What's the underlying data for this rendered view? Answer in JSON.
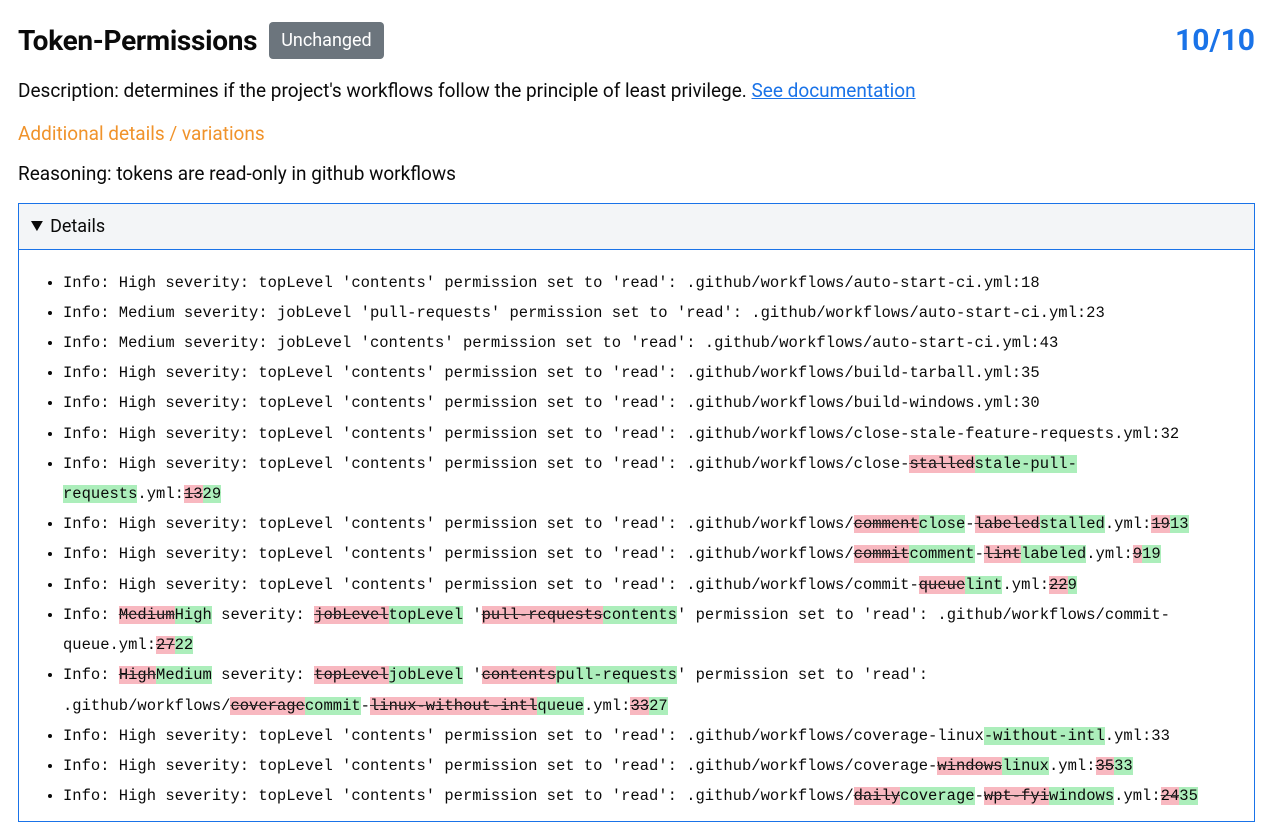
{
  "header": {
    "title": "Token-Permissions",
    "badge": "Unchanged",
    "score": "10/10"
  },
  "description_prefix": "Description: determines if the project's workflows follow the principle of least privilege. ",
  "doc_link_label": "See documentation",
  "additional_label": "Additional details / variations",
  "reasoning": "Reasoning: tokens are read-only in github workflows",
  "details_summary": "Details",
  "items": [
    [
      {
        "t": "Info: High severity: topLevel 'contents' permission set to 'read': .github/workflows/auto-start-ci.yml:18"
      }
    ],
    [
      {
        "t": "Info: Medium severity: jobLevel 'pull-requests' permission set to 'read': .github/workflows/auto-start-ci.yml:23"
      }
    ],
    [
      {
        "t": "Info: Medium severity: jobLevel 'contents' permission set to 'read': .github/workflows/auto-start-ci.yml:43"
      }
    ],
    [
      {
        "t": "Info: High severity: topLevel 'contents' permission set to 'read': .github/workflows/build-tarball.yml:35"
      }
    ],
    [
      {
        "t": "Info: High severity: topLevel 'contents' permission set to 'read': .github/workflows/build-windows.yml:30"
      }
    ],
    [
      {
        "t": "Info: High severity: topLevel 'contents' permission set to 'read': .github/workflows/close-stale-feature-requests.yml:32"
      }
    ],
    [
      {
        "t": "Info: High severity: topLevel 'contents' permission set to 'read': .github/workflows/close-"
      },
      {
        "t": "stalled",
        "c": "del"
      },
      {
        "t": "stale-pull-requests",
        "c": "ins"
      },
      {
        "t": ".yml:"
      },
      {
        "t": "13",
        "c": "del"
      },
      {
        "t": "29",
        "c": "ins"
      }
    ],
    [
      {
        "t": "Info: High severity: topLevel 'contents' permission set to 'read': .github/workflows/"
      },
      {
        "t": "comment",
        "c": "del"
      },
      {
        "t": "close",
        "c": "ins"
      },
      {
        "t": "-"
      },
      {
        "t": "labeled",
        "c": "del"
      },
      {
        "t": "stalled",
        "c": "ins"
      },
      {
        "t": ".yml:"
      },
      {
        "t": "19",
        "c": "del"
      },
      {
        "t": "13",
        "c": "ins"
      }
    ],
    [
      {
        "t": "Info: High severity: topLevel 'contents' permission set to 'read': .github/workflows/"
      },
      {
        "t": "commit",
        "c": "del"
      },
      {
        "t": "comment",
        "c": "ins"
      },
      {
        "t": "-"
      },
      {
        "t": "lint",
        "c": "del"
      },
      {
        "t": "labeled",
        "c": "ins"
      },
      {
        "t": ".yml:"
      },
      {
        "t": "9",
        "c": "del"
      },
      {
        "t": "19",
        "c": "ins"
      }
    ],
    [
      {
        "t": "Info: High severity: topLevel 'contents' permission set to 'read': .github/workflows/commit-"
      },
      {
        "t": "queue",
        "c": "del"
      },
      {
        "t": "lint",
        "c": "ins"
      },
      {
        "t": ".yml:"
      },
      {
        "t": "22",
        "c": "del"
      },
      {
        "t": "9",
        "c": "ins"
      }
    ],
    [
      {
        "t": "Info: "
      },
      {
        "t": "Medium",
        "c": "del"
      },
      {
        "t": "High",
        "c": "ins"
      },
      {
        "t": " severity: "
      },
      {
        "t": "jobLevel",
        "c": "del"
      },
      {
        "t": "topLevel",
        "c": "ins"
      },
      {
        "t": " '"
      },
      {
        "t": "pull-requests",
        "c": "del"
      },
      {
        "t": "contents",
        "c": "ins"
      },
      {
        "t": "' permission set to 'read': .github/workflows/commit-queue.yml:"
      },
      {
        "t": "27",
        "c": "del"
      },
      {
        "t": "22",
        "c": "ins"
      }
    ],
    [
      {
        "t": "Info: "
      },
      {
        "t": "High",
        "c": "del"
      },
      {
        "t": "Medium",
        "c": "ins"
      },
      {
        "t": " severity: "
      },
      {
        "t": "topLevel",
        "c": "del"
      },
      {
        "t": "jobLevel",
        "c": "ins"
      },
      {
        "t": " '"
      },
      {
        "t": "contents",
        "c": "del"
      },
      {
        "t": "pull-requests",
        "c": "ins"
      },
      {
        "t": "' permission set to 'read': .github/workflows/"
      },
      {
        "t": "coverage",
        "c": "del"
      },
      {
        "t": "commit",
        "c": "ins"
      },
      {
        "t": "-"
      },
      {
        "t": "linux-without-intl",
        "c": "del"
      },
      {
        "t": "queue",
        "c": "ins"
      },
      {
        "t": ".yml:"
      },
      {
        "t": "33",
        "c": "del"
      },
      {
        "t": "27",
        "c": "ins"
      }
    ],
    [
      {
        "t": "Info: High severity: topLevel 'contents' permission set to 'read': .github/workflows/coverage-linux"
      },
      {
        "t": "-without-intl",
        "c": "ins"
      },
      {
        "t": ".yml:33"
      }
    ],
    [
      {
        "t": "Info: High severity: topLevel 'contents' permission set to 'read': .github/workflows/coverage-"
      },
      {
        "t": "windows",
        "c": "del"
      },
      {
        "t": "linux",
        "c": "ins"
      },
      {
        "t": ".yml:"
      },
      {
        "t": "35",
        "c": "del"
      },
      {
        "t": "33",
        "c": "ins"
      }
    ],
    [
      {
        "t": "Info: High severity: topLevel 'contents' permission set to 'read': .github/workflows/"
      },
      {
        "t": "daily",
        "c": "del"
      },
      {
        "t": "coverage",
        "c": "ins"
      },
      {
        "t": "-"
      },
      {
        "t": "wpt-fyi",
        "c": "del"
      },
      {
        "t": "windows",
        "c": "ins"
      },
      {
        "t": ".yml:"
      },
      {
        "t": "24",
        "c": "del"
      },
      {
        "t": "35",
        "c": "ins"
      }
    ]
  ]
}
